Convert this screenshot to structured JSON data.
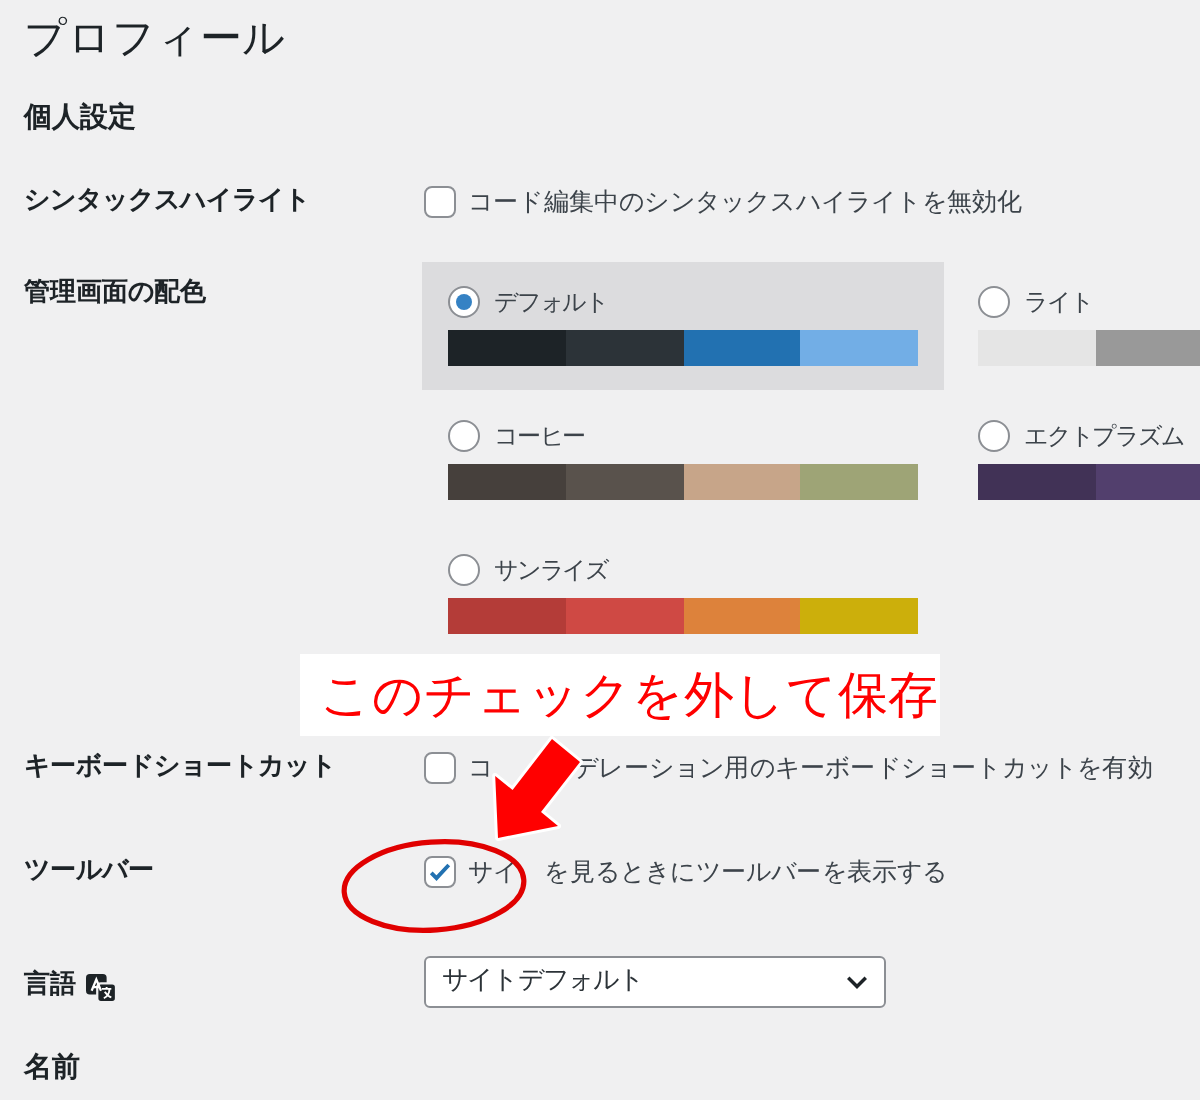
{
  "page_title": "プロフィール",
  "section_heading": "個人設定",
  "rows": [
    {
      "kind": "checkbox",
      "label": "シンタックスハイライト",
      "checked": false,
      "text_parts": [
        "コード編集中のシンタックスハイライトを無効化"
      ]
    },
    {
      "kind": "color_schemes",
      "label": "管理画面の配色",
      "schemes": [
        {
          "name": "デフォルト",
          "selected": true,
          "swatches": [
            {
              "color": "#1d2327"
            },
            {
              "color": "#2c3338"
            },
            {
              "color": "#2271b1"
            },
            {
              "color": "#72aee6"
            }
          ]
        },
        {
          "name": "ライト",
          "selected": false,
          "swatches": [
            {
              "color": "#e5e5e5"
            },
            {
              "color": "#999999"
            }
          ]
        },
        {
          "name": "コーヒー",
          "selected": false,
          "swatches": [
            {
              "color": "#46403c"
            },
            {
              "color": "#59524c"
            },
            {
              "color": "#c7a589"
            },
            {
              "color": "#9ea476"
            }
          ]
        },
        {
          "name": "エクトプラズム",
          "selected": false,
          "swatches": [
            {
              "color": "#413256"
            },
            {
              "color": "#523f6d"
            }
          ]
        },
        {
          "name": "サンライズ",
          "selected": false,
          "swatches": [
            {
              "color": "#b43c38"
            },
            {
              "color": "#cf4944"
            },
            {
              "color": "#dd823b"
            },
            {
              "color": "#ccaf0b"
            }
          ]
        }
      ]
    },
    {
      "kind": "checkbox",
      "label": "キーボードショートカット",
      "checked": false,
      "text_parts": [
        "コ",
        "デレーション用のキーボードショートカットを有効"
      ]
    },
    {
      "kind": "checkbox",
      "label": "ツールバー",
      "checked": true,
      "text_parts": [
        "サイ",
        "を見るときにツールバーを表示する"
      ]
    },
    {
      "kind": "select",
      "label": "言語",
      "value": "サイトデフォルト"
    }
  ],
  "next_heading": "名前",
  "annotation": {
    "text": "このチェックを外して保存"
  }
}
